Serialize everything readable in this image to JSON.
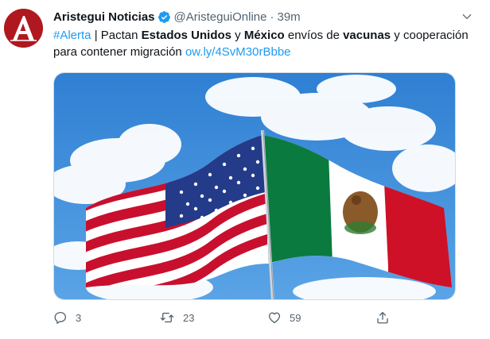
{
  "tweet": {
    "author_name": "Aristegui Noticias",
    "handle": "@AristeguiOnline",
    "separator": "·",
    "time": "39m",
    "avatar_letter": "A",
    "text": {
      "hashtag": "#Alerta",
      "part1": " | Pactan ",
      "bold1": "Estados Unidos",
      "part2": " y ",
      "bold2": "México",
      "part3": " envíos de ",
      "bold3": "vacunas",
      "part4": " y cooperación para contener migración ",
      "link": "ow.ly/4SvM30rBbbe"
    },
    "media": {
      "icon": "flags-photo",
      "description_colors": {
        "sky": "#3b86d6",
        "us_red": "#c8102e",
        "us_blue": "#243b8a",
        "mx_green": "#0b7a3e",
        "mx_red": "#ce1126"
      }
    },
    "actions": {
      "reply_count": "3",
      "retweet_count": "23",
      "like_count": "59"
    },
    "colors": {
      "accent": "#1d9bf0",
      "secondary_text": "#536471",
      "avatar_bg": "#b0181f"
    }
  }
}
